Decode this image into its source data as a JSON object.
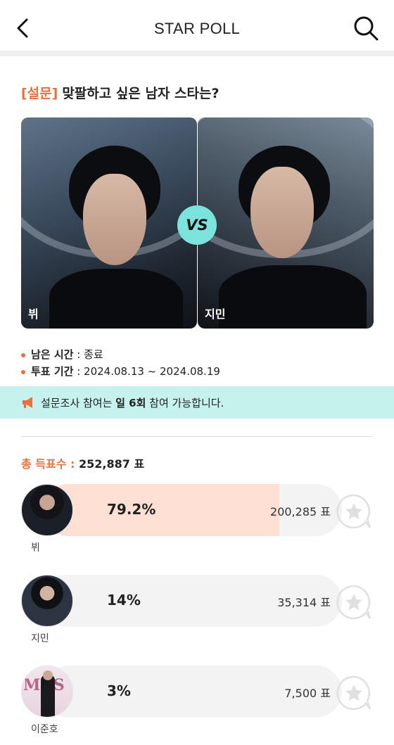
{
  "header": {
    "title": "STAR POLL"
  },
  "question": {
    "tag": "[설문]",
    "text": "맞팔하고 싶은 남자 스타는?"
  },
  "candidates": [
    {
      "label": "뷔"
    },
    {
      "label": "지민"
    }
  ],
  "vs_label": "VS",
  "info": {
    "remaining_label": "남은 시간",
    "remaining_value": " : 종료",
    "period_label": "투표 기간",
    "period_value": " : 2024.08.13 ~ 2024.08.19"
  },
  "notice": {
    "before": "설문조사 참여는 ",
    "bold": "일 6회",
    "after": " 참여 가능합니다."
  },
  "total": {
    "label": "총 득표수 :",
    "value": " 252,887 표"
  },
  "results": [
    {
      "name": "뷔",
      "percent": "79.2%",
      "votes": "200,285 표",
      "fill": 0.792
    },
    {
      "name": "지민",
      "percent": "14%",
      "votes": "35,314 표",
      "fill": 0.0
    },
    {
      "name": "이준호",
      "percent": "3%",
      "votes": "7,500 표",
      "fill": 0.0
    }
  ],
  "colors": {
    "accent": "#e8713b",
    "vs": "#7be3dc",
    "notice_bg": "#c6f2ee",
    "bar_fill": "#fde0d3"
  },
  "icons": {
    "back": "chevron-left-icon",
    "search": "search-icon",
    "notice": "megaphone-icon",
    "vote": "star-bubble-icon"
  }
}
